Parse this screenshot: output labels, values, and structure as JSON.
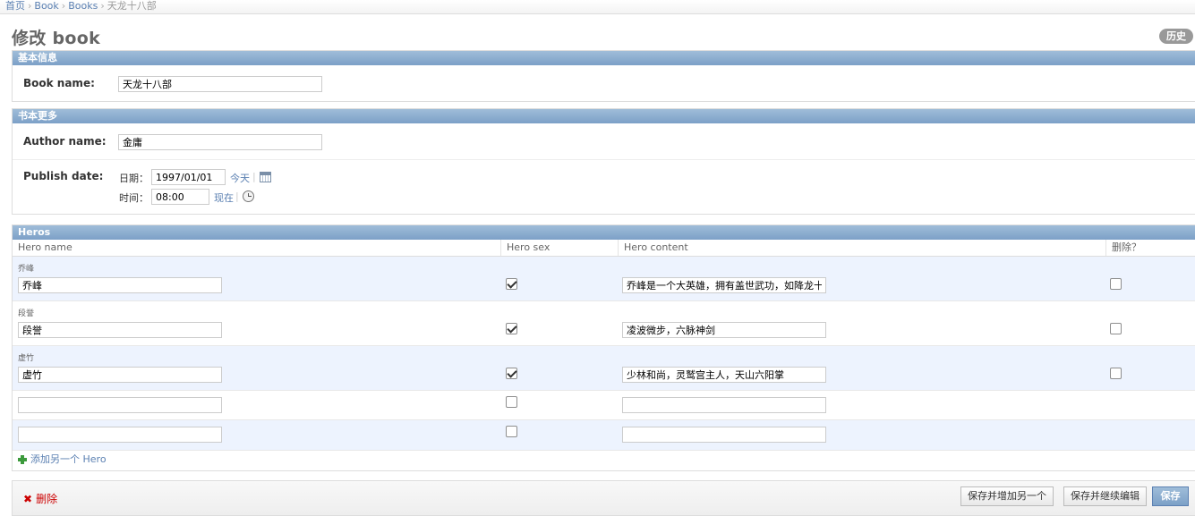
{
  "breadcrumbs": [
    "首页",
    "Book",
    "Books",
    "天龙十八部"
  ],
  "breadcrumb_separator": "›",
  "page_title": "修改 book",
  "history_button": "历史",
  "sections": {
    "basic": {
      "title": "基本信息",
      "book_name_label": "Book name:",
      "book_name_value": "天龙十八部"
    },
    "more": {
      "title": "书本更多",
      "author_name_label": "Author name:",
      "author_name_value": "金庸",
      "publish_date_label": "Publish date:",
      "date_label": "日期：",
      "date_value": "1997/01/01",
      "today_link": "今天",
      "time_label": "时间：",
      "time_value": "08:00",
      "now_link": "现在",
      "divider": "|"
    }
  },
  "heros": {
    "title": "Heros",
    "columns": [
      "Hero name",
      "Hero sex",
      "Hero content",
      "删除？"
    ],
    "rows": [
      {
        "caption": "乔峰",
        "name": "乔峰",
        "sex": true,
        "content": "乔峰是一个大英雄，拥有盖世武功，如降龙十",
        "delete": false
      },
      {
        "caption": "段誉",
        "name": "段誉",
        "sex": true,
        "content": "凌波微步，六脉神剑",
        "delete": false
      },
      {
        "caption": "虚竹",
        "name": "虚竹",
        "sex": true,
        "content": "少林和尚，灵鹫宫主人，天山六阳掌",
        "delete": false
      },
      {
        "caption": "",
        "name": "",
        "sex": false,
        "content": ""
      },
      {
        "caption": "",
        "name": "",
        "sex": false,
        "content": ""
      }
    ],
    "add_link": "添加另一个 Hero"
  },
  "submit": {
    "delete_link": "删除",
    "save_add_another": "保存并增加另一个",
    "save_continue": "保存并继续编辑",
    "save": "保存"
  },
  "colors": {
    "header_blue": "#7ca0c7",
    "link": "#5b80b2",
    "row_alt": "#edf3fe",
    "delete_red": "#cc0000"
  },
  "icons": [
    "calendar-icon",
    "clock-icon",
    "add-icon",
    "delete-icon",
    "checkbox-checked",
    "checkbox-unchecked"
  ]
}
